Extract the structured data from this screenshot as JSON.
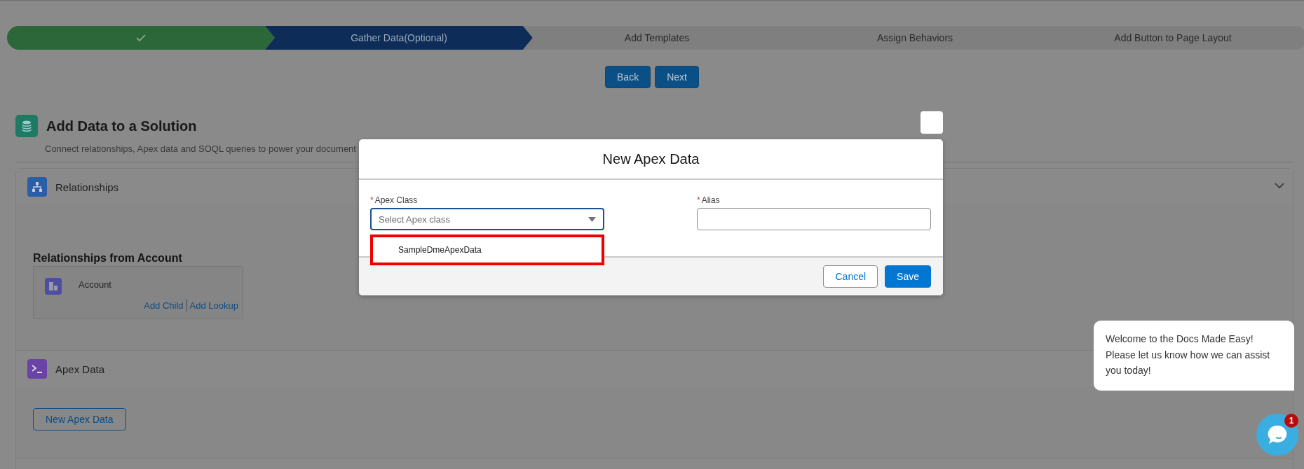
{
  "path": {
    "steps": [
      {
        "completed": true,
        "selected": false
      },
      {
        "label": "Gather Data(Optional)",
        "completed": false,
        "selected": true
      },
      {
        "label": "Add Templates",
        "completed": false,
        "selected": false
      },
      {
        "label": "Assign Behaviors",
        "completed": false,
        "selected": false
      },
      {
        "label": "Add Button to Page Layout",
        "completed": false,
        "selected": false
      }
    ],
    "buttons": [
      "Back",
      "Next"
    ]
  },
  "header": {
    "title": "Add Data to a Solution",
    "subtitle": "Connect relationships, Apex data and SOQL queries to power your document"
  },
  "sections": [
    {
      "kind": "relationships",
      "title": "Relationships",
      "expanded": true,
      "group_title": "Relationships from Account",
      "object": {
        "name": "Account",
        "links": [
          "Add Child",
          "Add Lookup"
        ]
      }
    },
    {
      "kind": "apex",
      "title": "Apex Data",
      "button": "New Apex Data"
    }
  ],
  "modal": {
    "title": "New Apex Data",
    "fields": [
      {
        "label": "Apex Class",
        "required_mark": "*",
        "placeholder": "Select Apex class",
        "kind": "select",
        "focused": true,
        "options": [
          {
            "label": "SampleDmeApexData",
            "highlighted": true
          }
        ]
      },
      {
        "label": "Alias",
        "required_mark": "*",
        "kind": "text",
        "focused": false
      }
    ],
    "buttons": [
      {
        "label": "Cancel",
        "kind": "neutral"
      },
      {
        "label": "Save",
        "kind": "brand"
      }
    ]
  },
  "chat": {
    "message_lines": [
      "Welcome to the Docs Made Easy!",
      "Please let us know how we can assist",
      "you today!"
    ],
    "badge": "1"
  }
}
